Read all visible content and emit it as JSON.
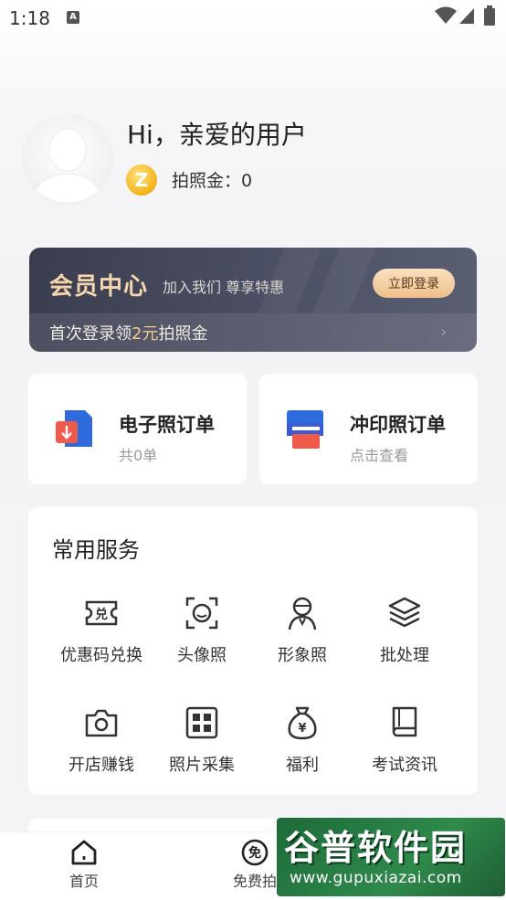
{
  "status_bar": {
    "time": "1:18",
    "notification_badge": "A"
  },
  "profile": {
    "greeting": "Hi，亲爱的用户",
    "coin_symbol": "Z",
    "coin_label": "拍照金：0"
  },
  "membership": {
    "title": "会员中心",
    "subtitle": "加入我们 尊享特惠",
    "login_button": "立即登录",
    "tip_prefix": "首次登录领",
    "tip_highlight": "2元",
    "tip_suffix": "拍照金"
  },
  "orders": [
    {
      "title": "电子照订单",
      "sub": "共0单",
      "icon": "digital-photo-order-icon"
    },
    {
      "title": "冲印照订单",
      "sub": "点击查看",
      "icon": "print-photo-order-icon"
    }
  ],
  "services": {
    "heading": "常用服务",
    "items": [
      {
        "label": "优惠码兑换",
        "icon": "coupon-exchange-icon"
      },
      {
        "label": "头像照",
        "icon": "face-frame-icon"
      },
      {
        "label": "形象照",
        "icon": "person-icon"
      },
      {
        "label": "批处理",
        "icon": "layers-icon"
      },
      {
        "label": "开店赚钱",
        "icon": "camera-icon"
      },
      {
        "label": "照片采集",
        "icon": "grid-icon"
      },
      {
        "label": "福利",
        "icon": "money-bag-icon"
      },
      {
        "label": "考试资讯",
        "icon": "book-icon"
      }
    ]
  },
  "bottom_nav": [
    {
      "label": "首页",
      "icon": "home-icon"
    },
    {
      "label": "免费拍",
      "icon": "free-icon",
      "icon_text": "免"
    }
  ],
  "watermark": {
    "title": "谷普软件园",
    "url": "www.gupuxiazai.com"
  },
  "colors": {
    "banner_gold": "#f6d6ad",
    "accent_blue": "#2f6bdc",
    "accent_red": "#ef5a4a"
  }
}
